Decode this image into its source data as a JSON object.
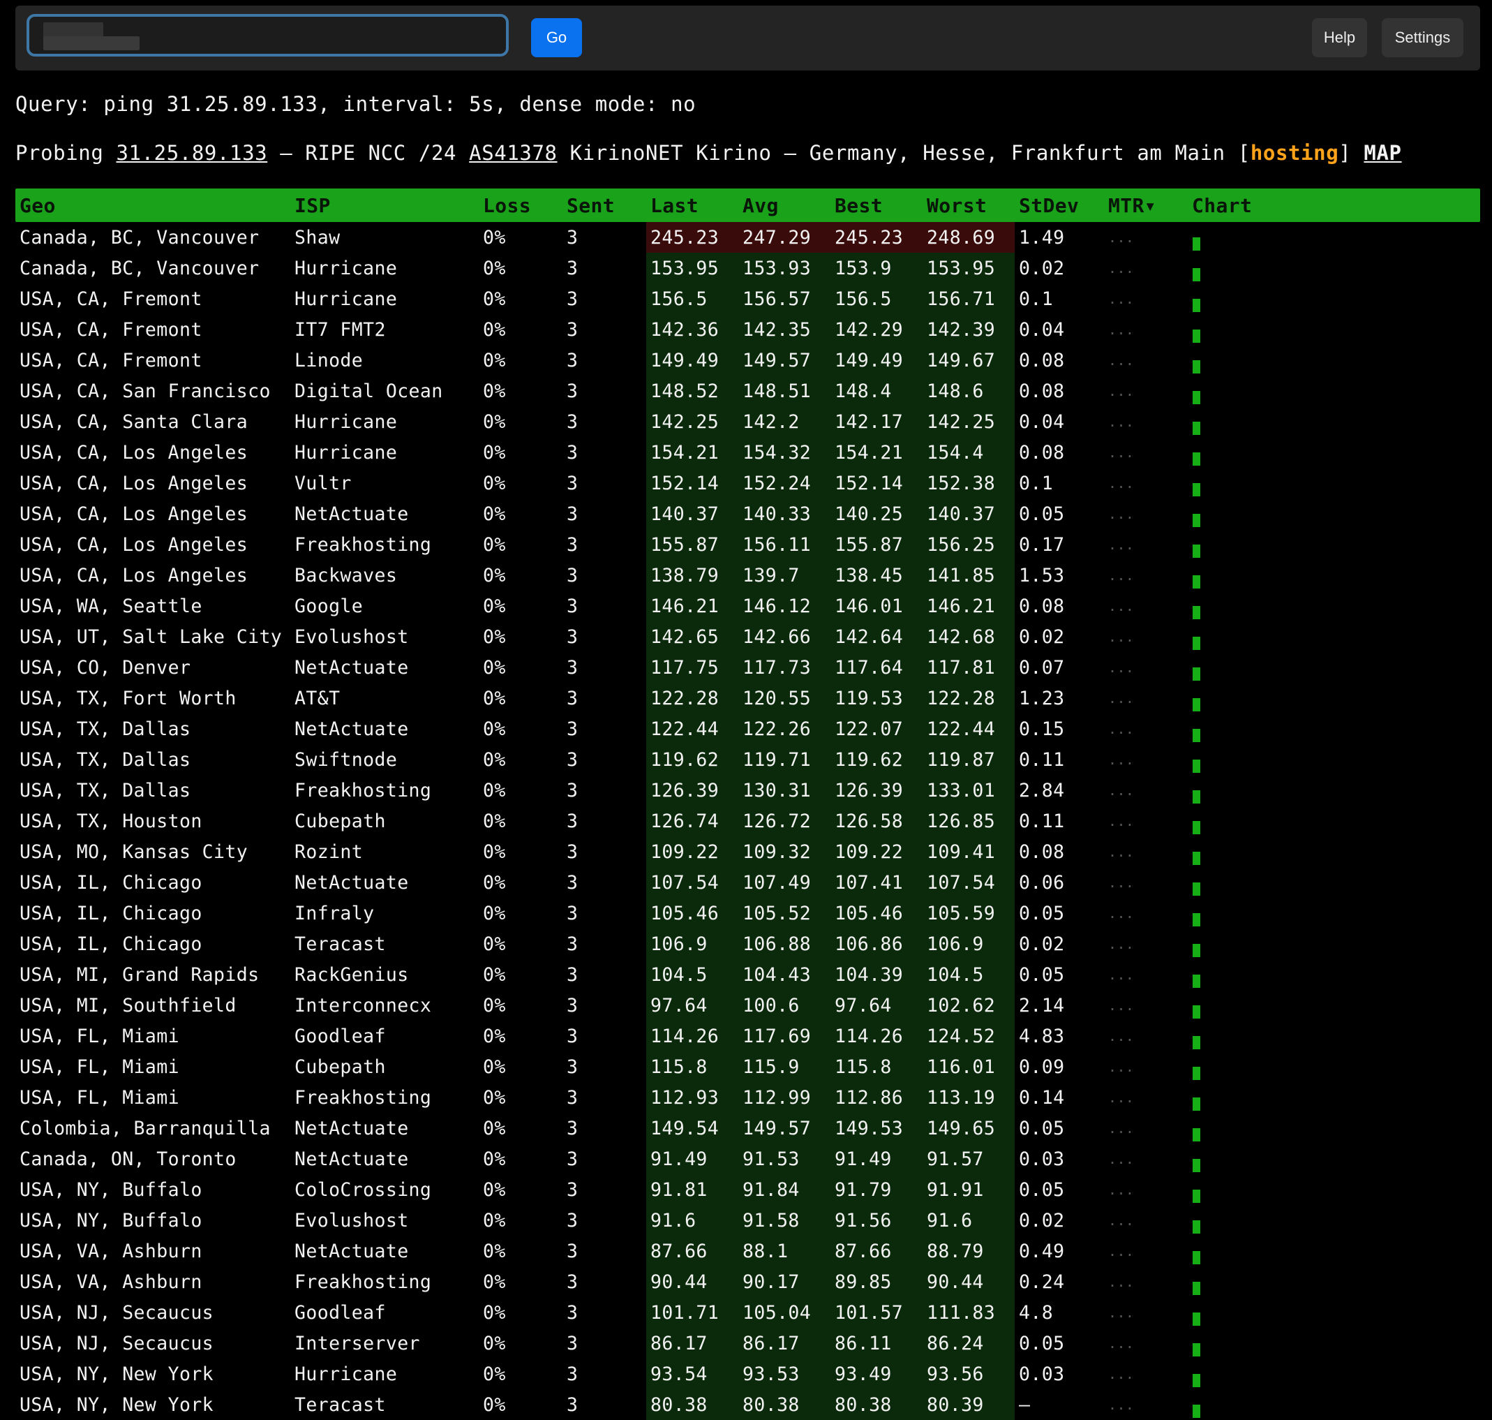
{
  "toolbar": {
    "search_value": "",
    "go_label": "Go",
    "help_label": "Help",
    "settings_label": "Settings"
  },
  "query_line": "Query: ping 31.25.89.133, interval: 5s, dense mode: no",
  "probe": {
    "prefix": "Probing ",
    "ip": "31.25.89.133",
    "mid1": " — RIPE NCC /24 ",
    "asn": "AS41378",
    "mid2": " KirinoNET Kirino — Germany, Hesse, Frankfurt am Main [",
    "tag": "hosting",
    "mid3": "] ",
    "map": "MAP"
  },
  "columns": {
    "geo": "Geo",
    "isp": "ISP",
    "loss": "Loss",
    "sent": "Sent",
    "last": "Last",
    "avg": "Avg",
    "best": "Best",
    "worst": "Worst",
    "stdev": "StDev",
    "mtr": "MTR▾",
    "chart": "Chart"
  },
  "colors": {
    "header_bg": "#1aa31a",
    "accent_button": "#0a72ee",
    "hosting_tag": "#ffa31a",
    "good_latency_bg": "#0b2a0b",
    "bad_latency_bg": "#3a0b0b",
    "chart_bar": "#16b016"
  },
  "mtr_placeholder": "...",
  "rows": [
    {
      "geo": "Canada, BC, Vancouver",
      "isp": "Shaw",
      "loss": "0%",
      "sent": "3",
      "last": "245.23",
      "avg": "247.29",
      "best": "245.23",
      "worst": "248.69",
      "stdev": "1.49"
    },
    {
      "geo": "Canada, BC, Vancouver",
      "isp": "Hurricane",
      "loss": "0%",
      "sent": "3",
      "last": "153.95",
      "avg": "153.93",
      "best": "153.9",
      "worst": "153.95",
      "stdev": "0.02"
    },
    {
      "geo": "USA, CA, Fremont",
      "isp": "Hurricane",
      "loss": "0%",
      "sent": "3",
      "last": "156.5",
      "avg": "156.57",
      "best": "156.5",
      "worst": "156.71",
      "stdev": "0.1"
    },
    {
      "geo": "USA, CA, Fremont",
      "isp": "IT7 FMT2",
      "loss": "0%",
      "sent": "3",
      "last": "142.36",
      "avg": "142.35",
      "best": "142.29",
      "worst": "142.39",
      "stdev": "0.04"
    },
    {
      "geo": "USA, CA, Fremont",
      "isp": "Linode",
      "loss": "0%",
      "sent": "3",
      "last": "149.49",
      "avg": "149.57",
      "best": "149.49",
      "worst": "149.67",
      "stdev": "0.08"
    },
    {
      "geo": "USA, CA, San Francisco",
      "isp": "Digital Ocean",
      "loss": "0%",
      "sent": "3",
      "last": "148.52",
      "avg": "148.51",
      "best": "148.4",
      "worst": "148.6",
      "stdev": "0.08"
    },
    {
      "geo": "USA, CA, Santa Clara",
      "isp": "Hurricane",
      "loss": "0%",
      "sent": "3",
      "last": "142.25",
      "avg": "142.2",
      "best": "142.17",
      "worst": "142.25",
      "stdev": "0.04"
    },
    {
      "geo": "USA, CA, Los Angeles",
      "isp": "Hurricane",
      "loss": "0%",
      "sent": "3",
      "last": "154.21",
      "avg": "154.32",
      "best": "154.21",
      "worst": "154.4",
      "stdev": "0.08"
    },
    {
      "geo": "USA, CA, Los Angeles",
      "isp": "Vultr",
      "loss": "0%",
      "sent": "3",
      "last": "152.14",
      "avg": "152.24",
      "best": "152.14",
      "worst": "152.38",
      "stdev": "0.1"
    },
    {
      "geo": "USA, CA, Los Angeles",
      "isp": "NetActuate",
      "loss": "0%",
      "sent": "3",
      "last": "140.37",
      "avg": "140.33",
      "best": "140.25",
      "worst": "140.37",
      "stdev": "0.05"
    },
    {
      "geo": "USA, CA, Los Angeles",
      "isp": "Freakhosting",
      "loss": "0%",
      "sent": "3",
      "last": "155.87",
      "avg": "156.11",
      "best": "155.87",
      "worst": "156.25",
      "stdev": "0.17"
    },
    {
      "geo": "USA, CA, Los Angeles",
      "isp": "Backwaves",
      "loss": "0%",
      "sent": "3",
      "last": "138.79",
      "avg": "139.7",
      "best": "138.45",
      "worst": "141.85",
      "stdev": "1.53"
    },
    {
      "geo": "USA, WA, Seattle",
      "isp": "Google",
      "loss": "0%",
      "sent": "3",
      "last": "146.21",
      "avg": "146.12",
      "best": "146.01",
      "worst": "146.21",
      "stdev": "0.08"
    },
    {
      "geo": "USA, UT, Salt Lake City",
      "isp": "Evolushost",
      "loss": "0%",
      "sent": "3",
      "last": "142.65",
      "avg": "142.66",
      "best": "142.64",
      "worst": "142.68",
      "stdev": "0.02"
    },
    {
      "geo": "USA, CO, Denver",
      "isp": "NetActuate",
      "loss": "0%",
      "sent": "3",
      "last": "117.75",
      "avg": "117.73",
      "best": "117.64",
      "worst": "117.81",
      "stdev": "0.07"
    },
    {
      "geo": "USA, TX, Fort Worth",
      "isp": "AT&T",
      "loss": "0%",
      "sent": "3",
      "last": "122.28",
      "avg": "120.55",
      "best": "119.53",
      "worst": "122.28",
      "stdev": "1.23"
    },
    {
      "geo": "USA, TX, Dallas",
      "isp": "NetActuate",
      "loss": "0%",
      "sent": "3",
      "last": "122.44",
      "avg": "122.26",
      "best": "122.07",
      "worst": "122.44",
      "stdev": "0.15"
    },
    {
      "geo": "USA, TX, Dallas",
      "isp": "Swiftnode",
      "loss": "0%",
      "sent": "3",
      "last": "119.62",
      "avg": "119.71",
      "best": "119.62",
      "worst": "119.87",
      "stdev": "0.11"
    },
    {
      "geo": "USA, TX, Dallas",
      "isp": "Freakhosting",
      "loss": "0%",
      "sent": "3",
      "last": "126.39",
      "avg": "130.31",
      "best": "126.39",
      "worst": "133.01",
      "stdev": "2.84"
    },
    {
      "geo": "USA, TX, Houston",
      "isp": "Cubepath",
      "loss": "0%",
      "sent": "3",
      "last": "126.74",
      "avg": "126.72",
      "best": "126.58",
      "worst": "126.85",
      "stdev": "0.11"
    },
    {
      "geo": "USA, MO, Kansas City",
      "isp": "Rozint",
      "loss": "0%",
      "sent": "3",
      "last": "109.22",
      "avg": "109.32",
      "best": "109.22",
      "worst": "109.41",
      "stdev": "0.08"
    },
    {
      "geo": "USA, IL, Chicago",
      "isp": "NetActuate",
      "loss": "0%",
      "sent": "3",
      "last": "107.54",
      "avg": "107.49",
      "best": "107.41",
      "worst": "107.54",
      "stdev": "0.06"
    },
    {
      "geo": "USA, IL, Chicago",
      "isp": "Infraly",
      "loss": "0%",
      "sent": "3",
      "last": "105.46",
      "avg": "105.52",
      "best": "105.46",
      "worst": "105.59",
      "stdev": "0.05"
    },
    {
      "geo": "USA, IL, Chicago",
      "isp": "Teracast",
      "loss": "0%",
      "sent": "3",
      "last": "106.9",
      "avg": "106.88",
      "best": "106.86",
      "worst": "106.9",
      "stdev": "0.02"
    },
    {
      "geo": "USA, MI, Grand Rapids",
      "isp": "RackGenius",
      "loss": "0%",
      "sent": "3",
      "last": "104.5",
      "avg": "104.43",
      "best": "104.39",
      "worst": "104.5",
      "stdev": "0.05"
    },
    {
      "geo": "USA, MI, Southfield",
      "isp": "Interconnecx",
      "loss": "0%",
      "sent": "3",
      "last": "97.64",
      "avg": "100.6",
      "best": "97.64",
      "worst": "102.62",
      "stdev": "2.14"
    },
    {
      "geo": "USA, FL, Miami",
      "isp": "Goodleaf",
      "loss": "0%",
      "sent": "3",
      "last": "114.26",
      "avg": "117.69",
      "best": "114.26",
      "worst": "124.52",
      "stdev": "4.83"
    },
    {
      "geo": "USA, FL, Miami",
      "isp": "Cubepath",
      "loss": "0%",
      "sent": "3",
      "last": "115.8",
      "avg": "115.9",
      "best": "115.8",
      "worst": "116.01",
      "stdev": "0.09"
    },
    {
      "geo": "USA, FL, Miami",
      "isp": "Freakhosting",
      "loss": "0%",
      "sent": "3",
      "last": "112.93",
      "avg": "112.99",
      "best": "112.86",
      "worst": "113.19",
      "stdev": "0.14"
    },
    {
      "geo": "Colombia, Barranquilla",
      "isp": "NetActuate",
      "loss": "0%",
      "sent": "3",
      "last": "149.54",
      "avg": "149.57",
      "best": "149.53",
      "worst": "149.65",
      "stdev": "0.05"
    },
    {
      "geo": "Canada, ON, Toronto",
      "isp": "NetActuate",
      "loss": "0%",
      "sent": "3",
      "last": "91.49",
      "avg": "91.53",
      "best": "91.49",
      "worst": "91.57",
      "stdev": "0.03"
    },
    {
      "geo": "USA, NY, Buffalo",
      "isp": "ColoCrossing",
      "loss": "0%",
      "sent": "3",
      "last": "91.81",
      "avg": "91.84",
      "best": "91.79",
      "worst": "91.91",
      "stdev": "0.05"
    },
    {
      "geo": "USA, NY, Buffalo",
      "isp": "Evolushost",
      "loss": "0%",
      "sent": "3",
      "last": "91.6",
      "avg": "91.58",
      "best": "91.56",
      "worst": "91.6",
      "stdev": "0.02"
    },
    {
      "geo": "USA, VA, Ashburn",
      "isp": "NetActuate",
      "loss": "0%",
      "sent": "3",
      "last": "87.66",
      "avg": "88.1",
      "best": "87.66",
      "worst": "88.79",
      "stdev": "0.49"
    },
    {
      "geo": "USA, VA, Ashburn",
      "isp": "Freakhosting",
      "loss": "0%",
      "sent": "3",
      "last": "90.44",
      "avg": "90.17",
      "best": "89.85",
      "worst": "90.44",
      "stdev": "0.24"
    },
    {
      "geo": "USA, NJ, Secaucus",
      "isp": "Goodleaf",
      "loss": "0%",
      "sent": "3",
      "last": "101.71",
      "avg": "105.04",
      "best": "101.57",
      "worst": "111.83",
      "stdev": "4.8"
    },
    {
      "geo": "USA, NJ, Secaucus",
      "isp": "Interserver",
      "loss": "0%",
      "sent": "3",
      "last": "86.17",
      "avg": "86.17",
      "best": "86.11",
      "worst": "86.24",
      "stdev": "0.05"
    },
    {
      "geo": "USA, NY, New York",
      "isp": "Hurricane",
      "loss": "0%",
      "sent": "3",
      "last": "93.54",
      "avg": "93.53",
      "best": "93.49",
      "worst": "93.56",
      "stdev": "0.03"
    },
    {
      "geo": "USA, NY, New York",
      "isp": "Teracast",
      "loss": "0%",
      "sent": "3",
      "last": "80.38",
      "avg": "80.38",
      "best": "80.38",
      "worst": "80.39",
      "stdev": "–"
    }
  ]
}
